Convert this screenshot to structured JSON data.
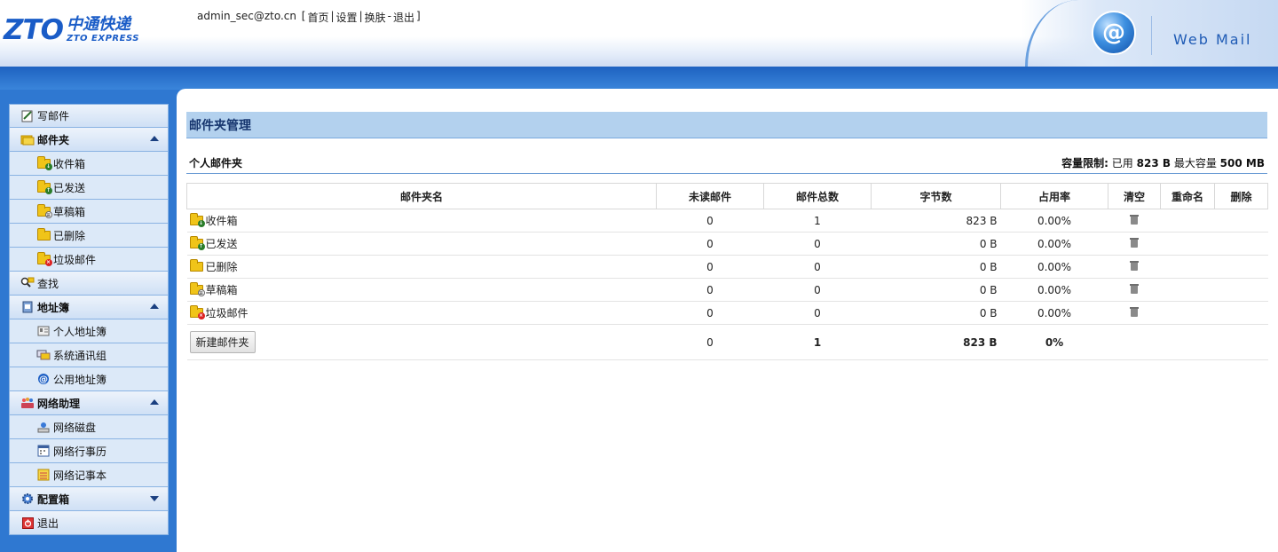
{
  "header": {
    "logo_mark": "ZTO",
    "logo_cn": "中通快递",
    "logo_en": "ZTO EXPRESS",
    "user_email": "admin_sec@zto.cn",
    "link_home": "首页",
    "link_settings": "设置",
    "link_skin": "换肤",
    "link_logout": "退出",
    "brand": "Web Mail"
  },
  "sidebar": {
    "compose": "写邮件",
    "mail_folders": {
      "label": "邮件夹",
      "items": [
        "收件箱",
        "已发送",
        "草稿箱",
        "已删除",
        "垃圾邮件"
      ]
    },
    "search": "查找",
    "address_book": {
      "label": "地址簿",
      "items": [
        "个人地址簿",
        "系统通讯组",
        "公用地址簿"
      ]
    },
    "net_assistant": {
      "label": "网络助理",
      "items": [
        "网络磁盘",
        "网络行事历",
        "网络记事本"
      ]
    },
    "config": {
      "label": "配置箱"
    },
    "logout": "退出"
  },
  "main": {
    "title": "邮件夹管理",
    "section": "个人邮件夹",
    "quota_label": "容量限制:",
    "quota_used_prefix": "已用",
    "quota_used": "823 B",
    "quota_max_prefix": "最大容量",
    "quota_max": "500 MB",
    "columns": [
      "邮件夹名",
      "未读邮件",
      "邮件总数",
      "字节数",
      "占用率",
      "清空",
      "重命名",
      "删除"
    ],
    "rows": [
      {
        "name": "收件箱",
        "unread": "0",
        "total": "1",
        "bytes": "823 B",
        "usage": "0.00%"
      },
      {
        "name": "已发送",
        "unread": "0",
        "total": "0",
        "bytes": "0 B",
        "usage": "0.00%"
      },
      {
        "name": "已删除",
        "unread": "0",
        "total": "0",
        "bytes": "0 B",
        "usage": "0.00%"
      },
      {
        "name": "草稿箱",
        "unread": "0",
        "total": "0",
        "bytes": "0 B",
        "usage": "0.00%"
      },
      {
        "name": "垃圾邮件",
        "unread": "0",
        "total": "0",
        "bytes": "0 B",
        "usage": "0.00%"
      }
    ],
    "new_folder_button": "新建邮件夹",
    "totals": {
      "unread": "0",
      "total": "1",
      "bytes": "823 B",
      "usage": "0%"
    }
  },
  "colors": {
    "header_blue": "#2f78d1",
    "title_bar": "#b3d1ee",
    "sidebar_bg": "#dce9f8"
  }
}
